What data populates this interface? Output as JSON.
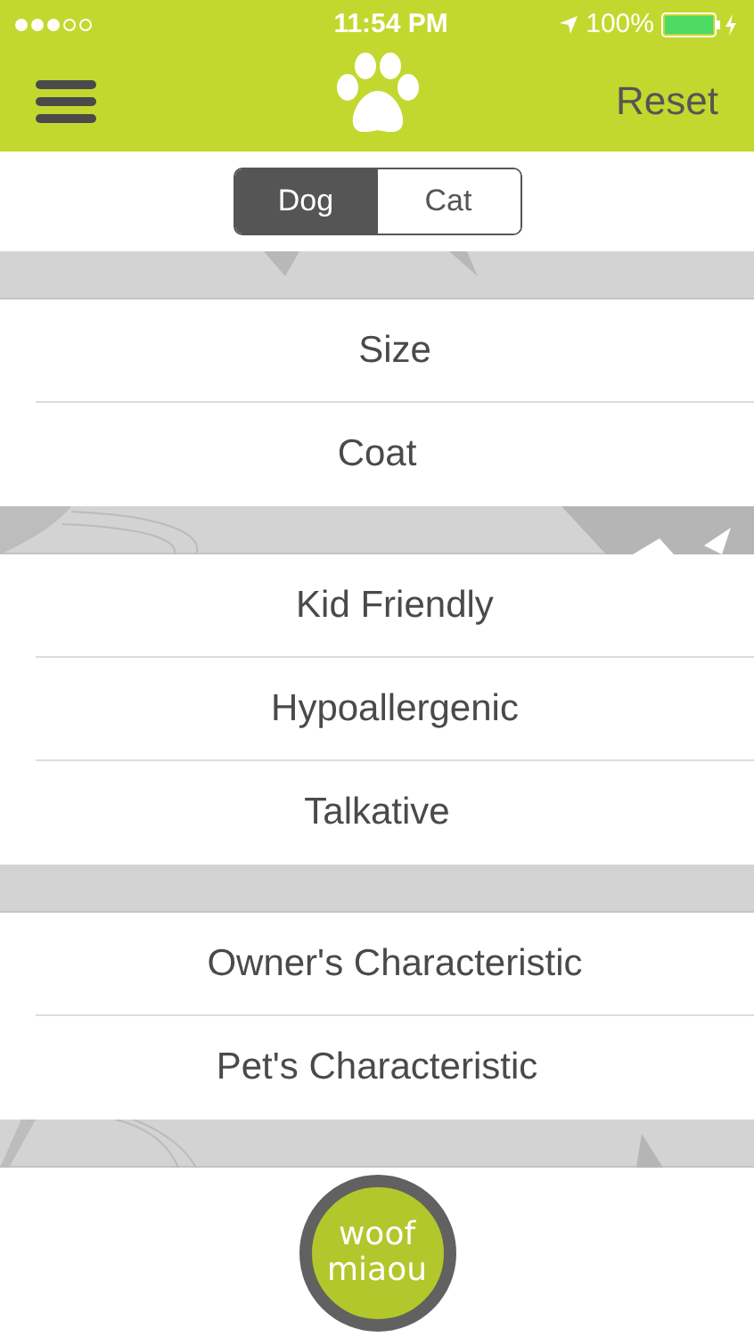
{
  "status_bar": {
    "time": "11:54 PM",
    "battery": "100%"
  },
  "nav": {
    "action": "Reset"
  },
  "segments": [
    {
      "label": "Dog",
      "selected": true
    },
    {
      "label": "Cat",
      "selected": false
    }
  ],
  "sections": [
    {
      "items": [
        "Size",
        "Coat"
      ]
    },
    {
      "items": [
        "Kid Friendly",
        "Hypoallergenic",
        "Talkative"
      ]
    },
    {
      "items": [
        "Owner's Characteristic",
        "Pet's Characteristic"
      ]
    }
  ],
  "logo": {
    "lines": [
      "woof",
      "miaou"
    ]
  }
}
